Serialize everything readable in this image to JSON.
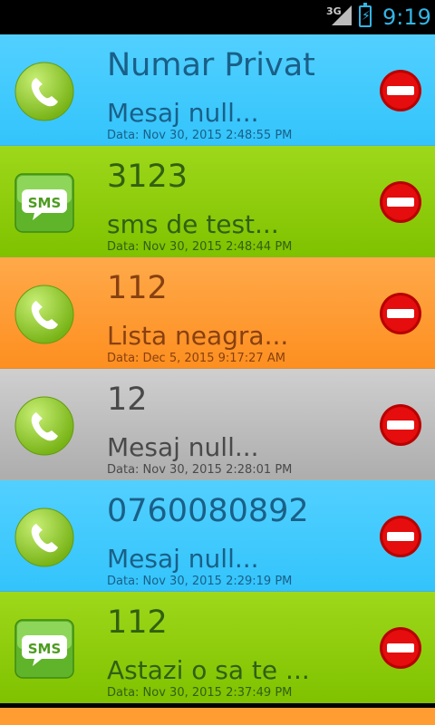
{
  "status_bar": {
    "network": "3G",
    "time": "9:19",
    "signal_icon": "signal-icon",
    "battery_icon": "battery-charging-icon",
    "accent_color": "#33b5e5"
  },
  "rows": [
    {
      "type": "call",
      "color": "blue",
      "title": "Numar Privat",
      "message": "Mesaj null...",
      "date": "Data: Nov 30, 2015 2:48:55 PM"
    },
    {
      "type": "sms",
      "color": "green",
      "title": "3123",
      "message": "sms de test...",
      "date": "Data: Nov 30, 2015 2:48:44 PM"
    },
    {
      "type": "call",
      "color": "orange",
      "title": "112",
      "message": "Lista neagra...",
      "date": "Data: Dec 5, 2015 9:17:27 AM"
    },
    {
      "type": "call",
      "color": "gray",
      "title": "12",
      "message": "Mesaj null...",
      "date": "Data: Nov 30, 2015 2:28:01 PM"
    },
    {
      "type": "call",
      "color": "blue",
      "title": "0760080892",
      "message": "Mesaj null...",
      "date": "Data: Nov 30, 2015 2:29:19 PM"
    },
    {
      "type": "sms",
      "color": "green",
      "title": "112",
      "message": "Astazi o sa te ...",
      "date": "Data: Nov 30, 2015 2:37:49 PM"
    }
  ],
  "icons": {
    "call": "phone-call-icon",
    "sms": "sms-message-icon",
    "delete": "delete-remove-icon",
    "sms_label": "SMS"
  }
}
